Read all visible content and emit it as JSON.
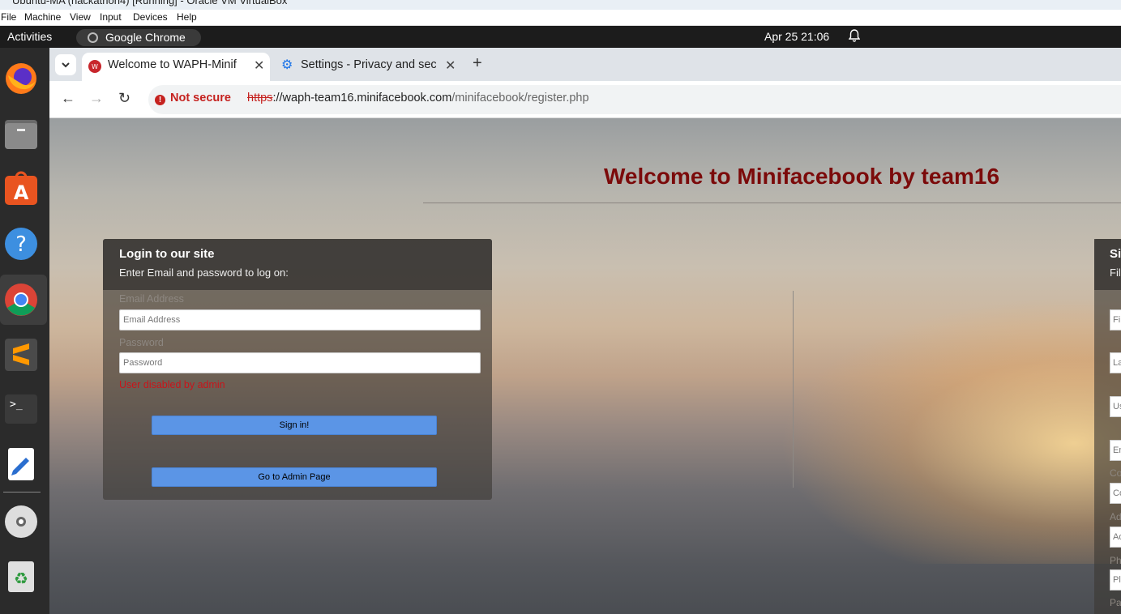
{
  "vbox": {
    "title": "Ubuntu-MA (hackathon4) [Running] - Oracle VM VirtualBox",
    "menu": [
      "File",
      "Machine",
      "View",
      "Input",
      "Devices",
      "Help"
    ]
  },
  "topbar": {
    "activities": "Activities",
    "app": "Google Chrome",
    "clock": "Apr 25  21:06"
  },
  "dock": [
    "firefox-icon",
    "files-icon",
    "app-center-icon",
    "help-icon",
    "chrome-icon",
    "sublime-text-icon",
    "terminal-icon",
    "text-editor-icon",
    "dvd-icon",
    "trash-icon"
  ],
  "browser": {
    "tabs": [
      {
        "label": "Welcome to WAPH-Minif",
        "active": true
      },
      {
        "label": "Settings - Privacy and sec",
        "active": false
      }
    ],
    "security": "Not secure",
    "url": {
      "scheme": "https",
      "sep": "://",
      "host": "waph-team16.minifacebook.com",
      "path": "/minifacebook/register.php"
    }
  },
  "page": {
    "title": "Welcome to Minifacebook by team16",
    "login": {
      "heading": "Login to our site",
      "subheading": "Enter Email and password to log on:",
      "email_label": "Email Address",
      "email_placeholder": "Email Address",
      "password_label": "Password",
      "password_placeholder": "Password",
      "error": "User disabled by admin",
      "signin": "Sign in!",
      "admin": "Go to Admin Page"
    },
    "signup": {
      "heading": "Si",
      "subheading": "Fil",
      "fields": [
        "Fi",
        "La",
        "Us",
        "En",
        "Co",
        "Ad",
        "Pl"
      ],
      "labels": [
        "Co",
        "Ad",
        "Ph",
        "Pa"
      ]
    }
  }
}
